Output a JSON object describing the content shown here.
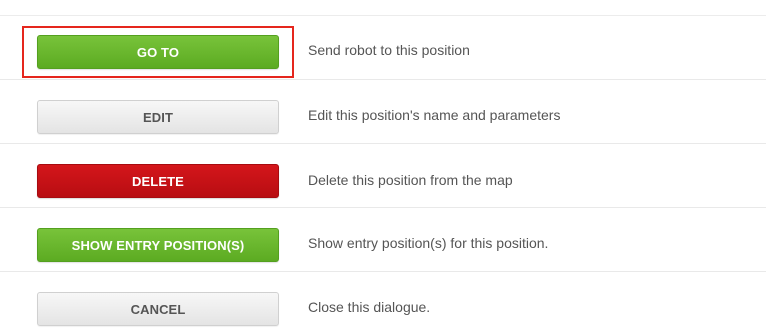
{
  "dialog": {
    "actions": [
      {
        "id": "goto",
        "button_label": "GO TO",
        "description": "Send robot to this position",
        "style": "green"
      },
      {
        "id": "edit",
        "button_label": "EDIT",
        "description": "Edit this position's name and parameters",
        "style": "gray"
      },
      {
        "id": "delete",
        "button_label": "DELETE",
        "description": "Delete this position from the map",
        "style": "red"
      },
      {
        "id": "show-entry",
        "button_label": "SHOW ENTRY POSITION(S)",
        "description": "Show entry position(s) for this position.",
        "style": "green"
      },
      {
        "id": "cancel",
        "button_label": "CANCEL",
        "description": "Close this dialogue.",
        "style": "gray"
      }
    ]
  },
  "colors": {
    "green": "#5fae25",
    "red": "#c31116",
    "gray": "#eeeeee",
    "highlight": "#e5261d",
    "text": "#555555"
  }
}
